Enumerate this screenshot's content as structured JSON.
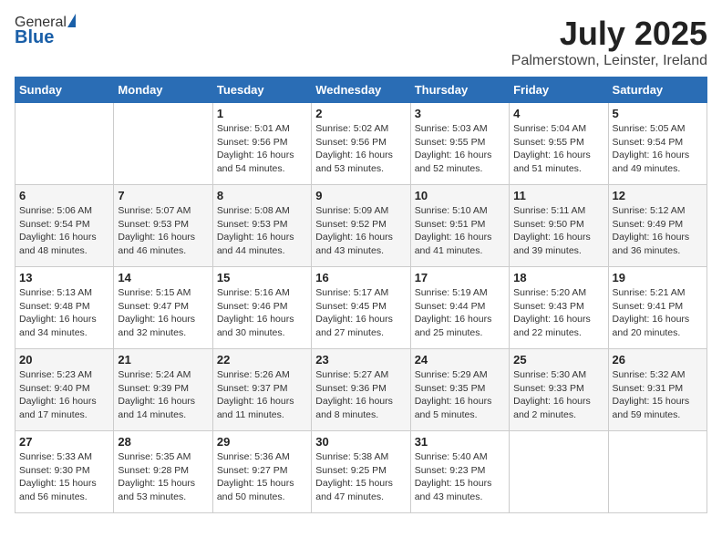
{
  "header": {
    "logo_general": "General",
    "logo_blue": "Blue",
    "title": "July 2025",
    "location": "Palmerstown, Leinster, Ireland"
  },
  "weekdays": [
    "Sunday",
    "Monday",
    "Tuesday",
    "Wednesday",
    "Thursday",
    "Friday",
    "Saturday"
  ],
  "weeks": [
    [
      {
        "day": "",
        "info": ""
      },
      {
        "day": "",
        "info": ""
      },
      {
        "day": "1",
        "info": "Sunrise: 5:01 AM\nSunset: 9:56 PM\nDaylight: 16 hours and 54 minutes."
      },
      {
        "day": "2",
        "info": "Sunrise: 5:02 AM\nSunset: 9:56 PM\nDaylight: 16 hours and 53 minutes."
      },
      {
        "day": "3",
        "info": "Sunrise: 5:03 AM\nSunset: 9:55 PM\nDaylight: 16 hours and 52 minutes."
      },
      {
        "day": "4",
        "info": "Sunrise: 5:04 AM\nSunset: 9:55 PM\nDaylight: 16 hours and 51 minutes."
      },
      {
        "day": "5",
        "info": "Sunrise: 5:05 AM\nSunset: 9:54 PM\nDaylight: 16 hours and 49 minutes."
      }
    ],
    [
      {
        "day": "6",
        "info": "Sunrise: 5:06 AM\nSunset: 9:54 PM\nDaylight: 16 hours and 48 minutes."
      },
      {
        "day": "7",
        "info": "Sunrise: 5:07 AM\nSunset: 9:53 PM\nDaylight: 16 hours and 46 minutes."
      },
      {
        "day": "8",
        "info": "Sunrise: 5:08 AM\nSunset: 9:53 PM\nDaylight: 16 hours and 44 minutes."
      },
      {
        "day": "9",
        "info": "Sunrise: 5:09 AM\nSunset: 9:52 PM\nDaylight: 16 hours and 43 minutes."
      },
      {
        "day": "10",
        "info": "Sunrise: 5:10 AM\nSunset: 9:51 PM\nDaylight: 16 hours and 41 minutes."
      },
      {
        "day": "11",
        "info": "Sunrise: 5:11 AM\nSunset: 9:50 PM\nDaylight: 16 hours and 39 minutes."
      },
      {
        "day": "12",
        "info": "Sunrise: 5:12 AM\nSunset: 9:49 PM\nDaylight: 16 hours and 36 minutes."
      }
    ],
    [
      {
        "day": "13",
        "info": "Sunrise: 5:13 AM\nSunset: 9:48 PM\nDaylight: 16 hours and 34 minutes."
      },
      {
        "day": "14",
        "info": "Sunrise: 5:15 AM\nSunset: 9:47 PM\nDaylight: 16 hours and 32 minutes."
      },
      {
        "day": "15",
        "info": "Sunrise: 5:16 AM\nSunset: 9:46 PM\nDaylight: 16 hours and 30 minutes."
      },
      {
        "day": "16",
        "info": "Sunrise: 5:17 AM\nSunset: 9:45 PM\nDaylight: 16 hours and 27 minutes."
      },
      {
        "day": "17",
        "info": "Sunrise: 5:19 AM\nSunset: 9:44 PM\nDaylight: 16 hours and 25 minutes."
      },
      {
        "day": "18",
        "info": "Sunrise: 5:20 AM\nSunset: 9:43 PM\nDaylight: 16 hours and 22 minutes."
      },
      {
        "day": "19",
        "info": "Sunrise: 5:21 AM\nSunset: 9:41 PM\nDaylight: 16 hours and 20 minutes."
      }
    ],
    [
      {
        "day": "20",
        "info": "Sunrise: 5:23 AM\nSunset: 9:40 PM\nDaylight: 16 hours and 17 minutes."
      },
      {
        "day": "21",
        "info": "Sunrise: 5:24 AM\nSunset: 9:39 PM\nDaylight: 16 hours and 14 minutes."
      },
      {
        "day": "22",
        "info": "Sunrise: 5:26 AM\nSunset: 9:37 PM\nDaylight: 16 hours and 11 minutes."
      },
      {
        "day": "23",
        "info": "Sunrise: 5:27 AM\nSunset: 9:36 PM\nDaylight: 16 hours and 8 minutes."
      },
      {
        "day": "24",
        "info": "Sunrise: 5:29 AM\nSunset: 9:35 PM\nDaylight: 16 hours and 5 minutes."
      },
      {
        "day": "25",
        "info": "Sunrise: 5:30 AM\nSunset: 9:33 PM\nDaylight: 16 hours and 2 minutes."
      },
      {
        "day": "26",
        "info": "Sunrise: 5:32 AM\nSunset: 9:31 PM\nDaylight: 15 hours and 59 minutes."
      }
    ],
    [
      {
        "day": "27",
        "info": "Sunrise: 5:33 AM\nSunset: 9:30 PM\nDaylight: 15 hours and 56 minutes."
      },
      {
        "day": "28",
        "info": "Sunrise: 5:35 AM\nSunset: 9:28 PM\nDaylight: 15 hours and 53 minutes."
      },
      {
        "day": "29",
        "info": "Sunrise: 5:36 AM\nSunset: 9:27 PM\nDaylight: 15 hours and 50 minutes."
      },
      {
        "day": "30",
        "info": "Sunrise: 5:38 AM\nSunset: 9:25 PM\nDaylight: 15 hours and 47 minutes."
      },
      {
        "day": "31",
        "info": "Sunrise: 5:40 AM\nSunset: 9:23 PM\nDaylight: 15 hours and 43 minutes."
      },
      {
        "day": "",
        "info": ""
      },
      {
        "day": "",
        "info": ""
      }
    ]
  ]
}
